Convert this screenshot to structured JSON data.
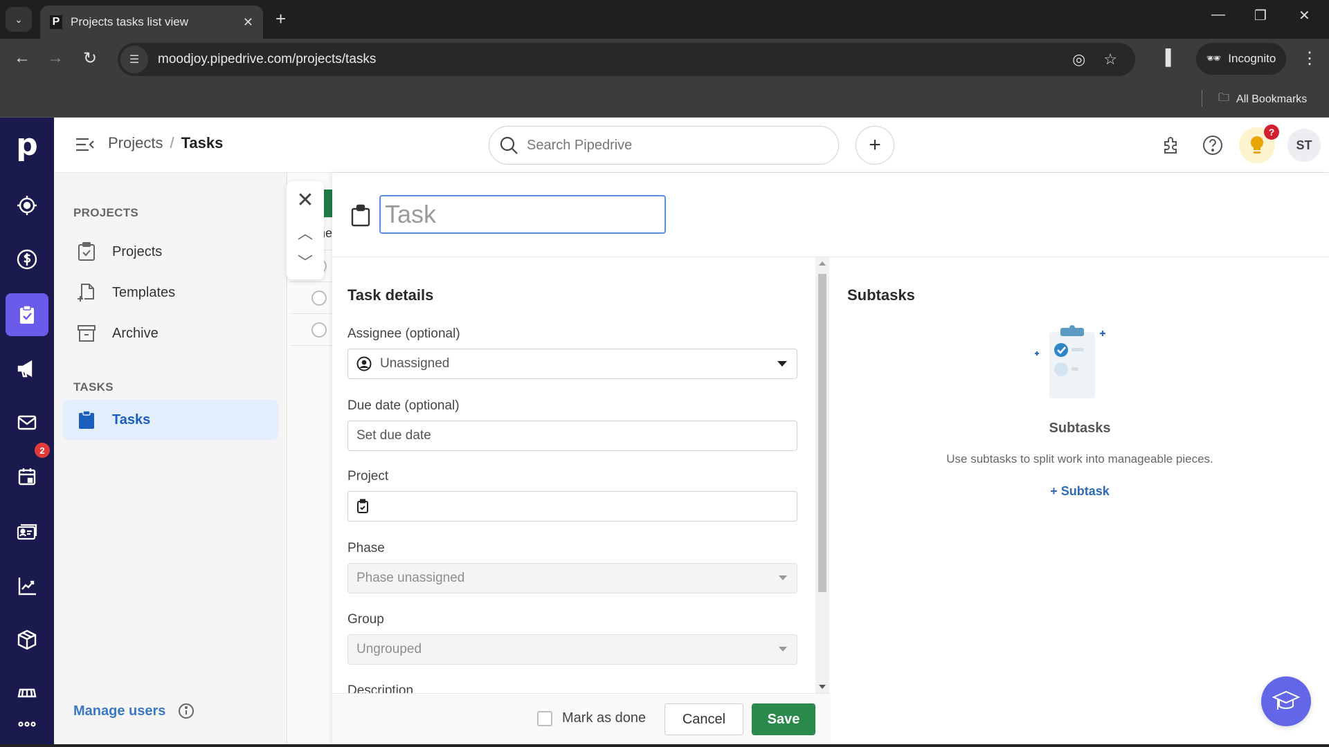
{
  "browser": {
    "tab_title": "Projects tasks list view",
    "favicon_letter": "P",
    "url": "moodjoy.pipedrive.com/projects/tasks",
    "incognito_label": "Incognito",
    "bookmarks_label": "All Bookmarks"
  },
  "header": {
    "breadcrumb_parent": "Projects",
    "breadcrumb_sep": "/",
    "breadcrumb_current": "Tasks",
    "search_placeholder": "Search Pipedrive",
    "add_label": "+",
    "tips_badge": "?",
    "avatar_initials": "ST"
  },
  "rail": {
    "logo": "p",
    "items": [
      "leads",
      "deals",
      "projects",
      "campaigns",
      "mail",
      "activities",
      "contacts",
      "insights",
      "products",
      "marketplace",
      "more"
    ],
    "activities_badge": "2"
  },
  "sidebar": {
    "section_projects": "PROJECTS",
    "items_projects": [
      {
        "label": "Projects"
      },
      {
        "label": "Templates"
      },
      {
        "label": "Archive"
      }
    ],
    "section_tasks": "TASKS",
    "items_tasks": [
      {
        "label": "Tasks",
        "active": true
      }
    ],
    "manage_users": "Manage users"
  },
  "background_list": {
    "header_fragment": "ne"
  },
  "dialog": {
    "title_placeholder": "Task",
    "title_value": "",
    "details_heading": "Task details",
    "fields": {
      "assignee_label": "Assignee (optional)",
      "assignee_value": "Unassigned",
      "due_label": "Due date (optional)",
      "due_placeholder": "Set due date",
      "project_label": "Project",
      "project_value": "",
      "phase_label": "Phase",
      "phase_value": "Phase unassigned",
      "group_label": "Group",
      "group_value": "Ungrouped",
      "description_label": "Description"
    },
    "subtasks": {
      "heading": "Subtasks",
      "empty_title": "Subtasks",
      "empty_desc": "Use subtasks to split work into manageable pieces.",
      "add_label": "+ Subtask"
    },
    "footer": {
      "mark_done_label": "Mark as done",
      "mark_done_checked": false,
      "cancel_label": "Cancel",
      "save_label": "Save"
    }
  },
  "colors": {
    "rail_bg": "#1b1a4e",
    "rail_active": "#6b5bea",
    "save_green": "#2a8a4b",
    "link_blue": "#3a78c3",
    "academy_purple": "#6366e6"
  }
}
